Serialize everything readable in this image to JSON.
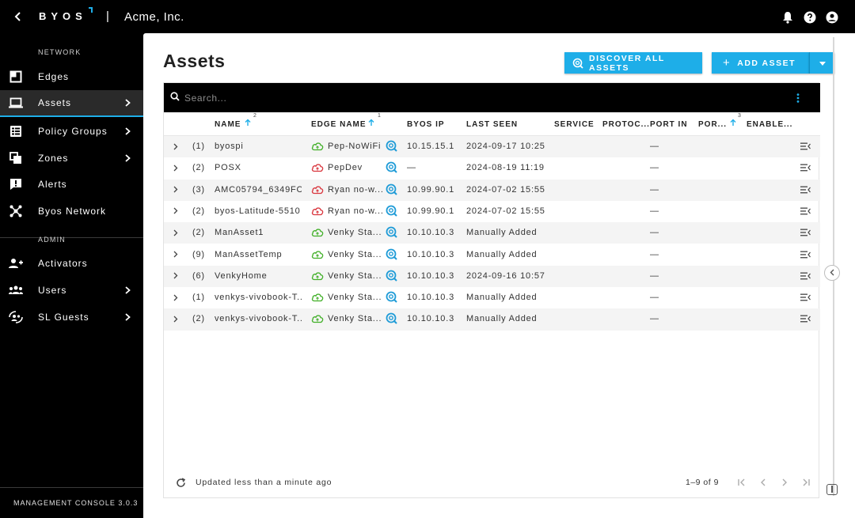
{
  "topbar": {
    "brand": "BYOS",
    "separator": "|",
    "organization": "Acme, Inc."
  },
  "sidebar": {
    "sections": [
      {
        "label": "NETWORK"
      },
      {
        "label": "ADMIN"
      }
    ],
    "items": [
      {
        "label": "Edges",
        "icon": "edges-icon",
        "active": false,
        "has_chevron": false
      },
      {
        "label": "Assets",
        "icon": "laptop-icon",
        "active": true,
        "has_chevron": true
      },
      {
        "label": "Policy Groups",
        "icon": "policy-groups-icon",
        "active": false,
        "has_chevron": true
      },
      {
        "label": "Zones",
        "icon": "zones-icon",
        "active": false,
        "has_chevron": true
      },
      {
        "label": "Alerts",
        "icon": "alert-icon",
        "active": false,
        "has_chevron": false
      },
      {
        "label": "Byos Network",
        "icon": "network-icon",
        "active": false,
        "has_chevron": false
      },
      {
        "label": "Activators",
        "icon": "activators-icon",
        "active": false,
        "has_chevron": false
      },
      {
        "label": "Users",
        "icon": "users-icon",
        "active": false,
        "has_chevron": true
      },
      {
        "label": "SL Guests",
        "icon": "guests-icon",
        "active": false,
        "has_chevron": true
      }
    ],
    "version": "MANAGEMENT CONSOLE 3.0.3"
  },
  "main": {
    "title": "Assets",
    "discover_label": "DISCOVER ALL ASSETS",
    "add_label": "ADD ASSET",
    "search_placeholder": "Search...",
    "columns": [
      {
        "label": "NAME",
        "sort_order": "2"
      },
      {
        "label": "EDGE NAME",
        "sort_order": "1"
      },
      {
        "label": "BYOS IP"
      },
      {
        "label": "LAST SEEN"
      },
      {
        "label": "SERVICE"
      },
      {
        "label": "PROTOC..."
      },
      {
        "label": "PORT IN"
      },
      {
        "label": "POR...",
        "sort_order": "3"
      },
      {
        "label": "ENABLE..."
      }
    ],
    "rows": [
      {
        "count": "(1)",
        "name": "byospi",
        "edge": "Pep-NoWiFi",
        "edge_status": "online",
        "ip": "10.15.15.1",
        "last_seen": "2024-09-17 10:25",
        "port_in": "—"
      },
      {
        "count": "(2)",
        "name": "POSX",
        "edge": "PepDev",
        "edge_status": "offline",
        "ip": "—",
        "last_seen": "2024-08-19 11:19",
        "port_in": "—"
      },
      {
        "count": "(3)",
        "name": "AMC05794_6349FC",
        "edge": "Ryan no-w...",
        "edge_status": "offline",
        "ip": "10.99.90.1",
        "last_seen": "2024-07-02 15:55",
        "port_in": "—"
      },
      {
        "count": "(2)",
        "name": "byos-Latitude-5510",
        "edge": "Ryan no-w...",
        "edge_status": "offline",
        "ip": "10.99.90.1",
        "last_seen": "2024-07-02 15:55",
        "port_in": "—"
      },
      {
        "count": "(2)",
        "name": "ManAsset1",
        "edge": "Venky Sta...",
        "edge_status": "online",
        "ip": "10.10.10.3",
        "last_seen": "Manually Added",
        "port_in": "—"
      },
      {
        "count": "(9)",
        "name": "ManAssetTemp",
        "edge": "Venky Sta...",
        "edge_status": "online",
        "ip": "10.10.10.3",
        "last_seen": "Manually Added",
        "port_in": "—"
      },
      {
        "count": "(6)",
        "name": "VenkyHome",
        "edge": "Venky Sta...",
        "edge_status": "online",
        "ip": "10.10.10.3",
        "last_seen": "2024-09-16 10:57",
        "port_in": "—"
      },
      {
        "count": "(1)",
        "name": "venkys-vivobook-T...",
        "edge": "Venky Sta...",
        "edge_status": "online",
        "ip": "10.10.10.3",
        "last_seen": "Manually Added",
        "port_in": "—"
      },
      {
        "count": "(2)",
        "name": "venkys-vivobook-T...",
        "edge": "Venky Sta...",
        "edge_status": "online",
        "ip": "10.10.10.3",
        "last_seen": "Manually Added",
        "port_in": "—"
      }
    ],
    "footer_status": "Updated less than a minute ago",
    "pager_range": "1–9 of 9"
  },
  "colors": {
    "accent": "#1eaee8",
    "online": "#43b02a",
    "offline": "#d9363e",
    "discover_icon": "#1e9bd7"
  }
}
